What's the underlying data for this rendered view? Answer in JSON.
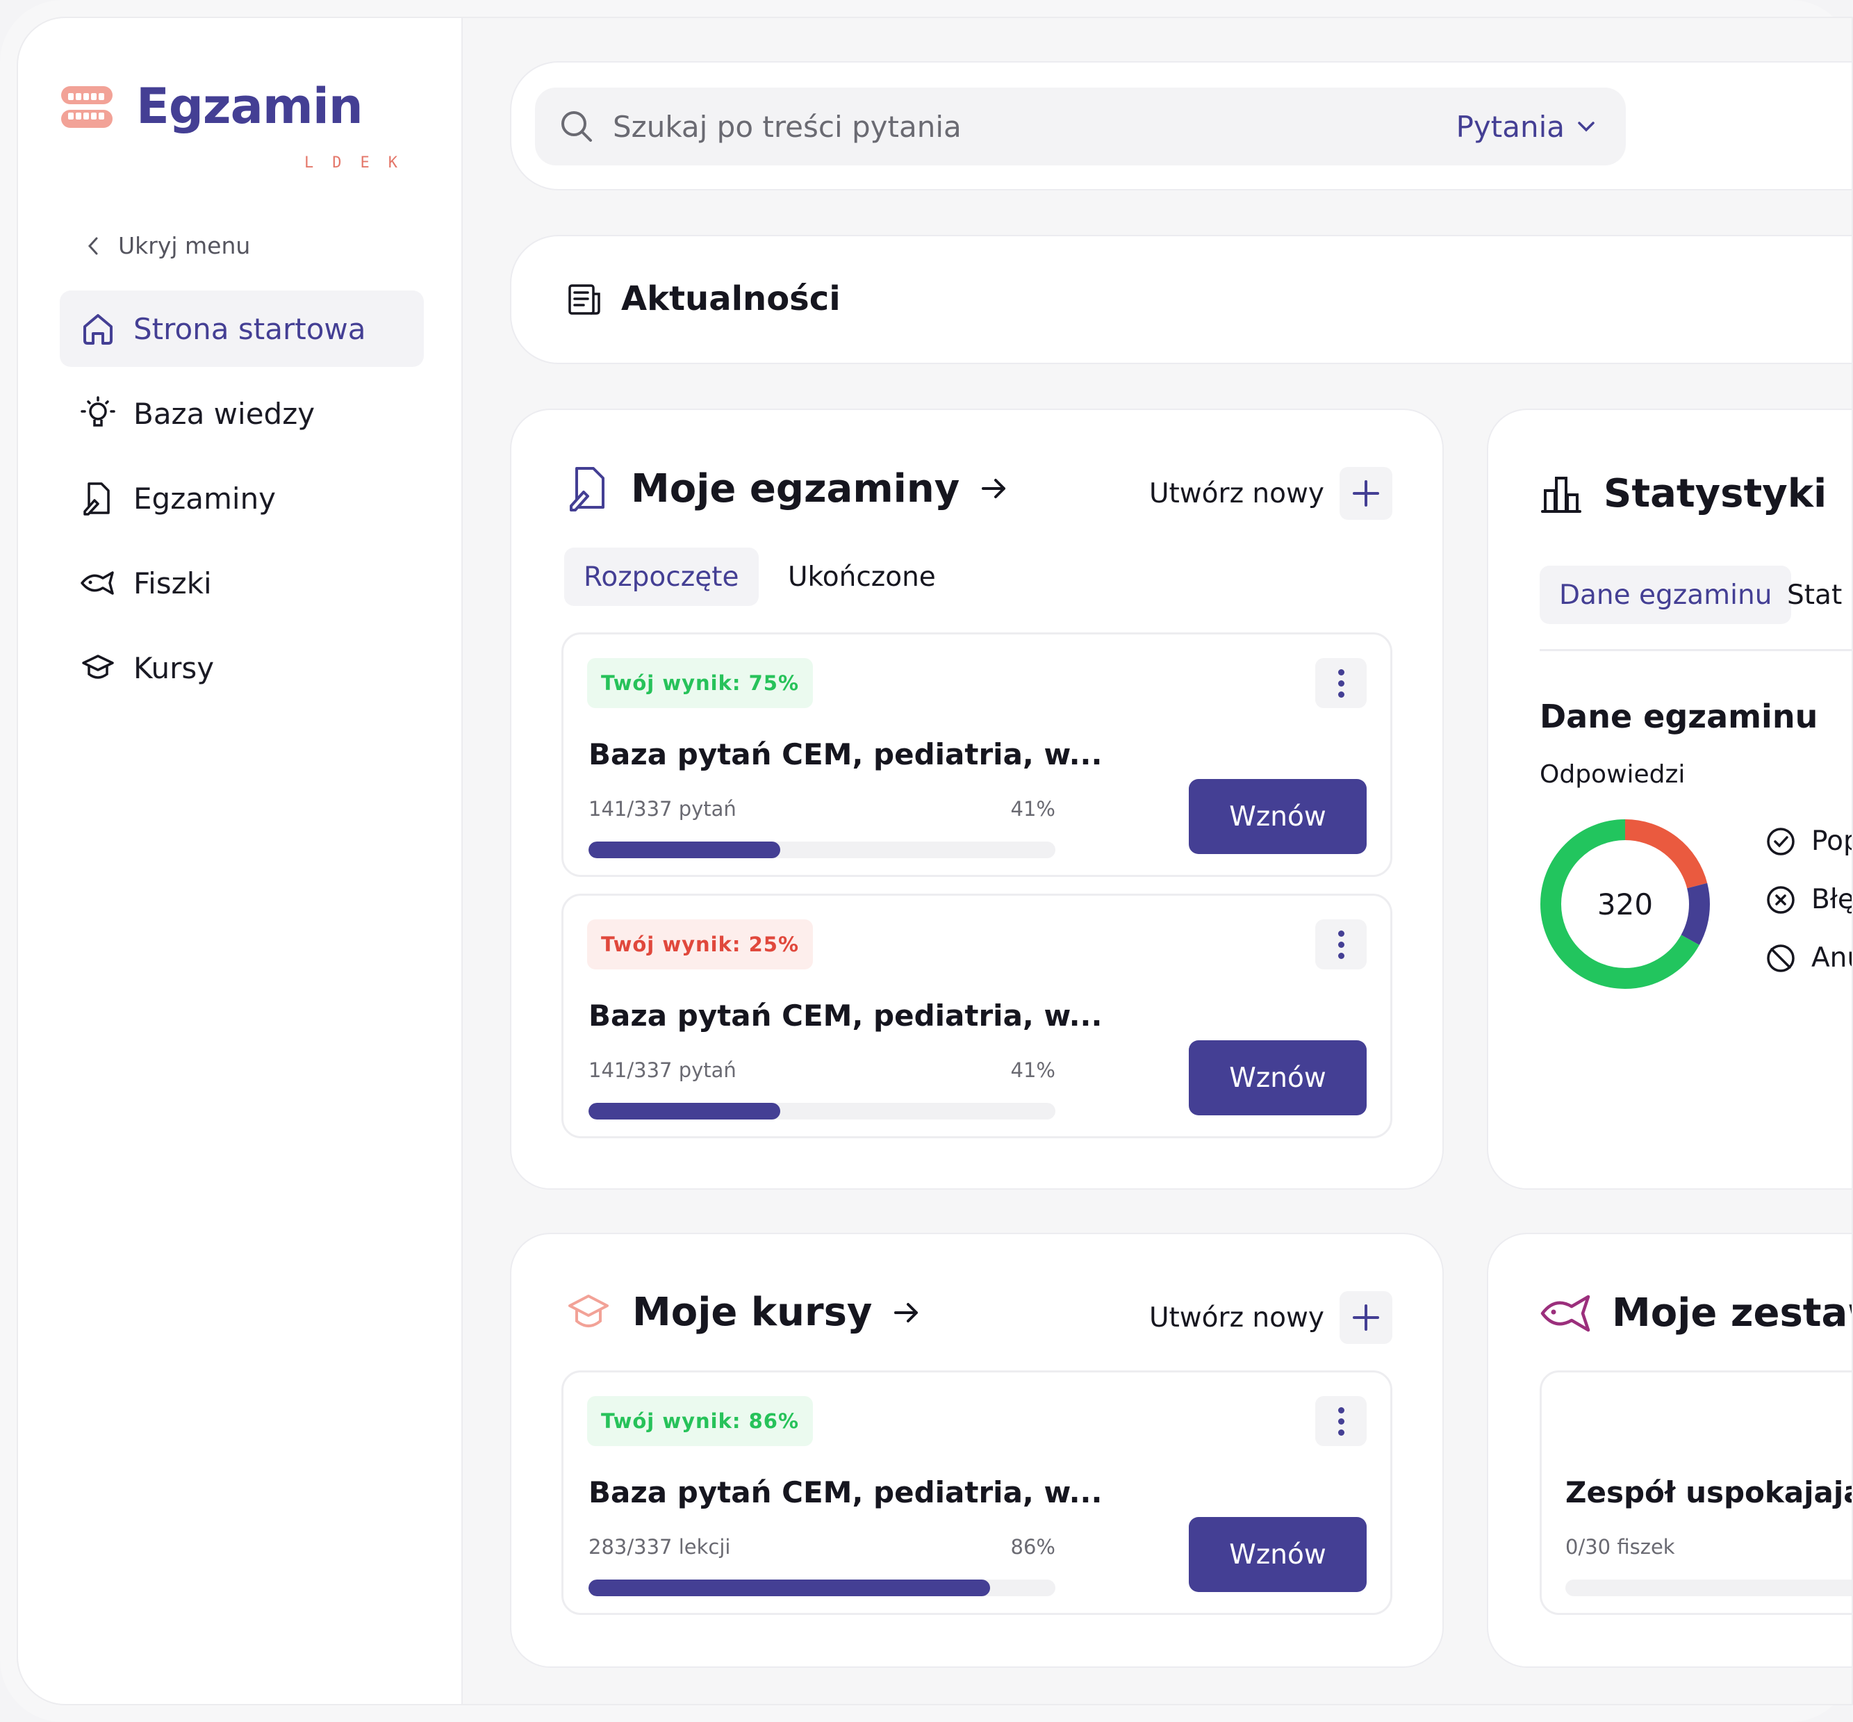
{
  "brand": {
    "name": "Egzamin",
    "sub": "LDEK"
  },
  "sidebar": {
    "hide_label": "Ukryj menu",
    "items": [
      {
        "label": "Strona startowa",
        "icon": "home-icon",
        "active": true
      },
      {
        "label": "Baza wiedzy",
        "icon": "lightbulb-icon",
        "active": false
      },
      {
        "label": "Egzaminy",
        "icon": "exam-icon",
        "active": false
      },
      {
        "label": "Fiszki",
        "icon": "fish-icon",
        "active": false
      },
      {
        "label": "Kursy",
        "icon": "graduation-cap-icon",
        "active": false
      }
    ]
  },
  "search": {
    "placeholder": "Szukaj po treści pytania",
    "scope": "Pytania"
  },
  "news": {
    "title": "Aktualności"
  },
  "exams": {
    "title": "Moje egzaminy",
    "create_label": "Utwórz nowy",
    "tabs": [
      {
        "label": "Rozpoczęte",
        "active": true
      },
      {
        "label": "Ukończone",
        "active": false
      }
    ],
    "items": [
      {
        "badge": "Twój wynik: 75%",
        "badge_tone": "good",
        "title": "Baza pytań CEM, pediatria, w...",
        "progress_label": "141/337 pytań",
        "percent_label": "41%",
        "progress": 0.41,
        "button": "Wznów"
      },
      {
        "badge": "Twój wynik: 25%",
        "badge_tone": "bad",
        "title": "Baza pytań CEM, pediatria, w...",
        "progress_label": "141/337 pytań",
        "percent_label": "41%",
        "progress": 0.41,
        "button": "Wznów"
      }
    ]
  },
  "stats": {
    "title": "Statystyki",
    "tabs": [
      {
        "label": "Dane egzaminu",
        "active": true
      },
      {
        "label": "Stat",
        "active": false
      }
    ],
    "section_title": "Dane egzaminu",
    "section_sub": "Odpowiedzi",
    "total": "320",
    "legend": [
      {
        "label": "Popr",
        "icon": "check-circle-icon"
      },
      {
        "label": "Błęd",
        "icon": "x-circle-icon"
      },
      {
        "label": "Anul",
        "icon": "ban-circle-icon"
      }
    ],
    "donut_fractions": {
      "correct": 0.67,
      "wrong": 0.21,
      "cancelled": 0.12
    },
    "colors": {
      "correct": "#22c55e",
      "wrong": "#ea5a3f",
      "cancelled": "#443f94"
    }
  },
  "courses": {
    "title": "Moje kursy",
    "create_label": "Utwórz nowy",
    "items": [
      {
        "badge": "Twój wynik: 86%",
        "badge_tone": "good",
        "title": "Baza pytań CEM, pediatria, w...",
        "progress_label": "283/337 lekcji",
        "percent_label": "86%",
        "progress": 0.86,
        "button": "Wznów"
      }
    ]
  },
  "sets": {
    "title": "Moje zestaw",
    "items": [
      {
        "title": "Zespół uspokajając",
        "progress_label": "0/30 fiszek"
      }
    ]
  },
  "colors": {
    "accent": "#443f94",
    "good": "#27c25a",
    "bad": "#e0483c"
  }
}
